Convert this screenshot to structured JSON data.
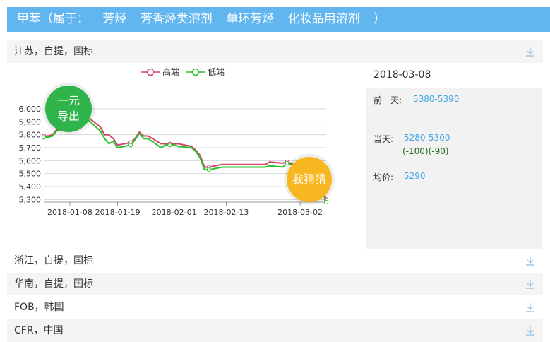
{
  "header": {
    "title": "甲苯（属于：",
    "tags": [
      "芳烃",
      "芳香烃类溶剂",
      "单环芳烃",
      "化妆品用溶剂"
    ],
    "close": "）"
  },
  "regions": [
    {
      "label": "江苏，自提，国标"
    },
    {
      "label": "浙江，自提，国标"
    },
    {
      "label": "华南，自提，国标"
    },
    {
      "label": "FOB，韩国"
    },
    {
      "label": "CFR，中国"
    }
  ],
  "buttons": {
    "export": "一元\n导出",
    "guess": "我猜猜"
  },
  "detail": {
    "date": "2018-03-08",
    "prev_label": "前一天:",
    "prev_value": "5380-5390",
    "today_label": "当天:",
    "today_value": "5280-5300",
    "today_change": "(-100)(-90)",
    "avg_label": "均价:",
    "avg_value": "5290"
  },
  "colors": {
    "header": "#62b6ef",
    "high": "#d0466a",
    "low": "#27c227",
    "export_bg": "#2fb34b",
    "guess_bg": "#f7b720",
    "link": "#44a5e3"
  },
  "chart_data": {
    "type": "line",
    "x": [
      "2018-01-02",
      "2018-01-03",
      "2018-01-04",
      "2018-01-05",
      "2018-01-08",
      "2018-01-09",
      "2018-01-10",
      "2018-01-11",
      "2018-01-12",
      "2018-01-15",
      "2018-01-16",
      "2018-01-17",
      "2018-01-18",
      "2018-01-19",
      "2018-01-22",
      "2018-01-23",
      "2018-01-24",
      "2018-01-25",
      "2018-01-26",
      "2018-01-29",
      "2018-01-30",
      "2018-01-31",
      "2018-02-01",
      "2018-02-02",
      "2018-02-05",
      "2018-02-06",
      "2018-02-07",
      "2018-02-08",
      "2018-02-09",
      "2018-02-12",
      "2018-02-13",
      "2018-02-14",
      "2018-02-22",
      "2018-02-23",
      "2018-02-26",
      "2018-02-27",
      "2018-02-28",
      "2018-03-01",
      "2018-03-02",
      "2018-03-05",
      "2018-03-06",
      "2018-03-07",
      "2018-03-08"
    ],
    "series": [
      {
        "name": "高端",
        "values": [
          5790,
          5790,
          5800,
          5840,
          5870,
          5900,
          5940,
          5980,
          5940,
          5860,
          5800,
          5800,
          5770,
          5720,
          5740,
          5770,
          5820,
          5790,
          5790,
          5730,
          5730,
          5730,
          5730,
          5730,
          5710,
          5680,
          5640,
          5550,
          5550,
          5570,
          5570,
          5570,
          5570,
          5590,
          5580,
          5590,
          5580,
          5560,
          5460,
          5350,
          5330,
          5390,
          5300
        ]
      },
      {
        "name": "低端",
        "values": [
          5780,
          5780,
          5790,
          5830,
          5860,
          5890,
          5930,
          5960,
          5920,
          5830,
          5770,
          5730,
          5750,
          5700,
          5720,
          5760,
          5810,
          5770,
          5770,
          5700,
          5720,
          5720,
          5720,
          5710,
          5700,
          5670,
          5620,
          5530,
          5530,
          5550,
          5550,
          5550,
          5550,
          5560,
          5550,
          5580,
          5570,
          5540,
          5430,
          5320,
          5300,
          5380,
          5280
        ]
      }
    ],
    "legend": [
      "高端",
      "低端"
    ],
    "xticks": [
      "2018-01-08",
      "2018-01-19",
      "2018-02-01",
      "2018-02-13",
      "2018-03-02"
    ],
    "yticks": [
      "5,300",
      "5,400",
      "5,500",
      "5,600",
      "5,700",
      "5,800",
      "5,900",
      "6,000"
    ],
    "ylim": [
      5280,
      6000
    ],
    "grid": true,
    "legend_position": "top-center"
  }
}
